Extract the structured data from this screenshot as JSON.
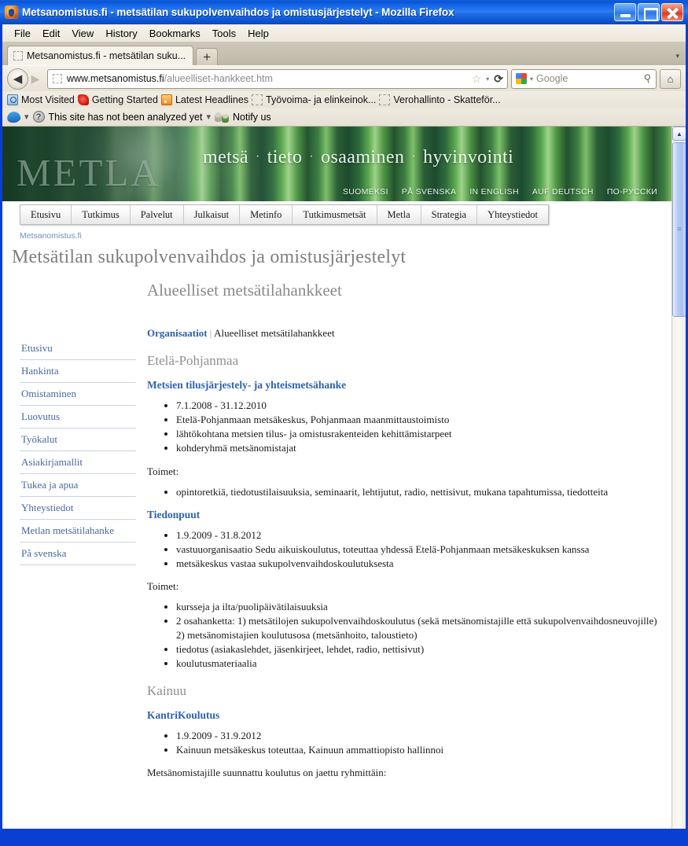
{
  "window": {
    "title": "Metsanomistus.fi - metsätilan sukupolvenvaihdos ja omistusjärjestelyt - Mozilla Firefox",
    "minimize_label": "_",
    "maximize_label": "□",
    "close_label": "✕"
  },
  "menubar": [
    {
      "label": "File"
    },
    {
      "label": "Edit"
    },
    {
      "label": "View"
    },
    {
      "label": "History"
    },
    {
      "label": "Bookmarks"
    },
    {
      "label": "Tools"
    },
    {
      "label": "Help"
    }
  ],
  "tabstrip": {
    "tab_label": "Metsanomistus.fi - metsätilan suku...",
    "newtab_label": "+",
    "list_caret": "▾"
  },
  "navbar": {
    "back_label": "◀",
    "forward_label": "▶",
    "url_main": "www.metsanomistus.fi",
    "url_path": "/alueelliset-hankkeet.htm",
    "star_label": "☆",
    "caret_label": "▾",
    "reload_label": "⟳",
    "search_placeholder": "Google",
    "search_caret": "▾",
    "magnifier_label": "⚲",
    "home_label": "⌂"
  },
  "bookmarks": [
    {
      "label": "Most Visited",
      "icon": "most-visited-icon"
    },
    {
      "label": "Getting Started",
      "icon": "getting-started-icon"
    },
    {
      "label": "Latest Headlines",
      "icon": "rss-icon"
    },
    {
      "label": "Työvoima- ja elinkeinok...",
      "icon": "blank-favicon"
    },
    {
      "label": "Verohallinto - Skatteför...",
      "icon": "blank-favicon"
    }
  ],
  "addonbar": {
    "wot_caret": "▾",
    "status_text": "This site has not been analyzed yet",
    "sep": "▾",
    "notify_label": "Notify us"
  },
  "banner": {
    "logo": "METLA",
    "slogan_words": [
      "metsä",
      "tieto",
      "osaaminen",
      "hyvinvointi"
    ],
    "slogan_dot": "·",
    "languages": [
      "SUOMEKSI",
      "PÅ SVENSKA",
      "IN ENGLISH",
      "AUF DEUTSCH",
      "ПО-РУССКИ"
    ]
  },
  "main_nav": [
    "Etusivu",
    "Tutkimus",
    "Palvelut",
    "Julkaisut",
    "Metinfo",
    "Tutkimusmetsät",
    "Metla",
    "Strategia",
    "Yhteystiedot"
  ],
  "site_crumb": "Metsanomistus.fi",
  "page_title": "Metsätilan sukupolvenvaihdos ja omistusjärjestelyt",
  "sidebar": {
    "items": [
      "Etusivu",
      "Hankinta",
      "Omistaminen",
      "Luovutus",
      "Työkalut",
      "Asiakirjamallit",
      "Tukea ja apua",
      "Yhteystiedot",
      "Metlan metsätilahanke",
      "På svenska"
    ]
  },
  "content": {
    "heading": "Alueelliset metsätilahankkeet",
    "breadcrumb": {
      "link": "Organisaatiot",
      "separator": "|",
      "current": "Alueelliset metsätilahankkeet"
    },
    "sections": [
      {
        "region": "Etelä-Pohjanmaa",
        "projects": [
          {
            "title": "Metsien tilusjärjestely- ja yhteismetsähanke",
            "facts": [
              "7.1.2008 - 31.12.2010",
              "Etelä-Pohjanmaan metsäkeskus, Pohjanmaan maanmittaustoimisto",
              "lähtökohtana metsien tilus- ja omistusrakenteiden kehittämistarpeet",
              "kohderyhmä metsänomistajat"
            ],
            "actions_label": "Toimet:",
            "actions": [
              "opintoretkiä, tiedotustilaisuuksia, seminaarit, lehtijutut, radio, nettisivut, mukana tapahtumissa, tiedotteita"
            ]
          },
          {
            "title": "Tiedonpuut",
            "facts": [
              "1.9.2009 - 31.8.2012",
              "vastuuorganisaatio Sedu aikuiskoulutus, toteuttaa yhdessä Etelä-Pohjanmaan metsäkeskuksen kanssa",
              "metsäkeskus vastaa sukupolvenvaihdoskoulutuksesta"
            ],
            "actions_label": "Toimet:",
            "actions": [
              "kursseja ja ilta/puolipäivätilaisuuksia",
              "2 osahanketta: 1) metsätilojen sukupolvenvaihdoskoulutus (sekä metsänomistajille että sukupolvenvaihdosneuvojille) 2) metsänomistajien koulutusosa (metsänhoito, taloustieto)",
              "tiedotus (asiakaslehdet, jäsenkirjeet, lehdet, radio, nettisivut)",
              "koulutusmateriaalia"
            ]
          }
        ]
      },
      {
        "region": "Kainuu",
        "projects": [
          {
            "title": "KantriKoulutus",
            "facts": [
              "1.9.2009 - 31.9.2012",
              "Kainuun metsäkeskus toteuttaa, Kainuun ammattiopisto hallinnoi"
            ],
            "actions_label": "Metsänomistajille suunnattu koulutus on jaettu ryhmittäin:",
            "actions": []
          }
        ]
      }
    ]
  },
  "scrollbar": {
    "up_label": "▲",
    "down_label": "▼",
    "grip_label": "≡"
  },
  "colors": {
    "titlebar_blue": "#0a3fd4",
    "link_blue": "#2f62ab",
    "sidebar_link": "#49689c",
    "banner_green": "#1b4a31",
    "heading_gray": "#8a8a8a"
  }
}
